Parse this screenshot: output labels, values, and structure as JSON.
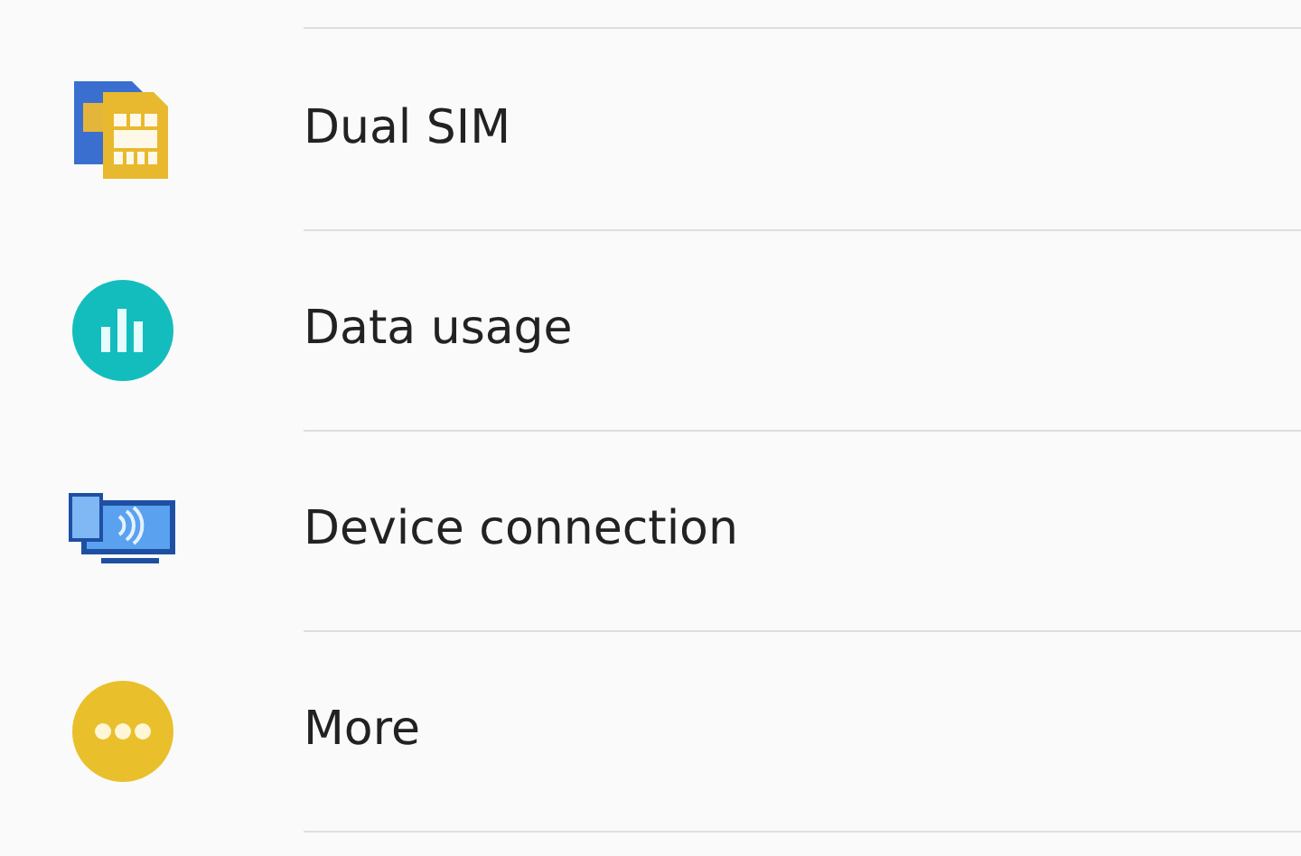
{
  "settings": [
    {
      "kind": "sim",
      "label": "Dual SIM"
    },
    {
      "kind": "data",
      "label": "Data usage"
    },
    {
      "kind": "device",
      "label": "Device connection"
    },
    {
      "kind": "more",
      "label": "More"
    }
  ]
}
